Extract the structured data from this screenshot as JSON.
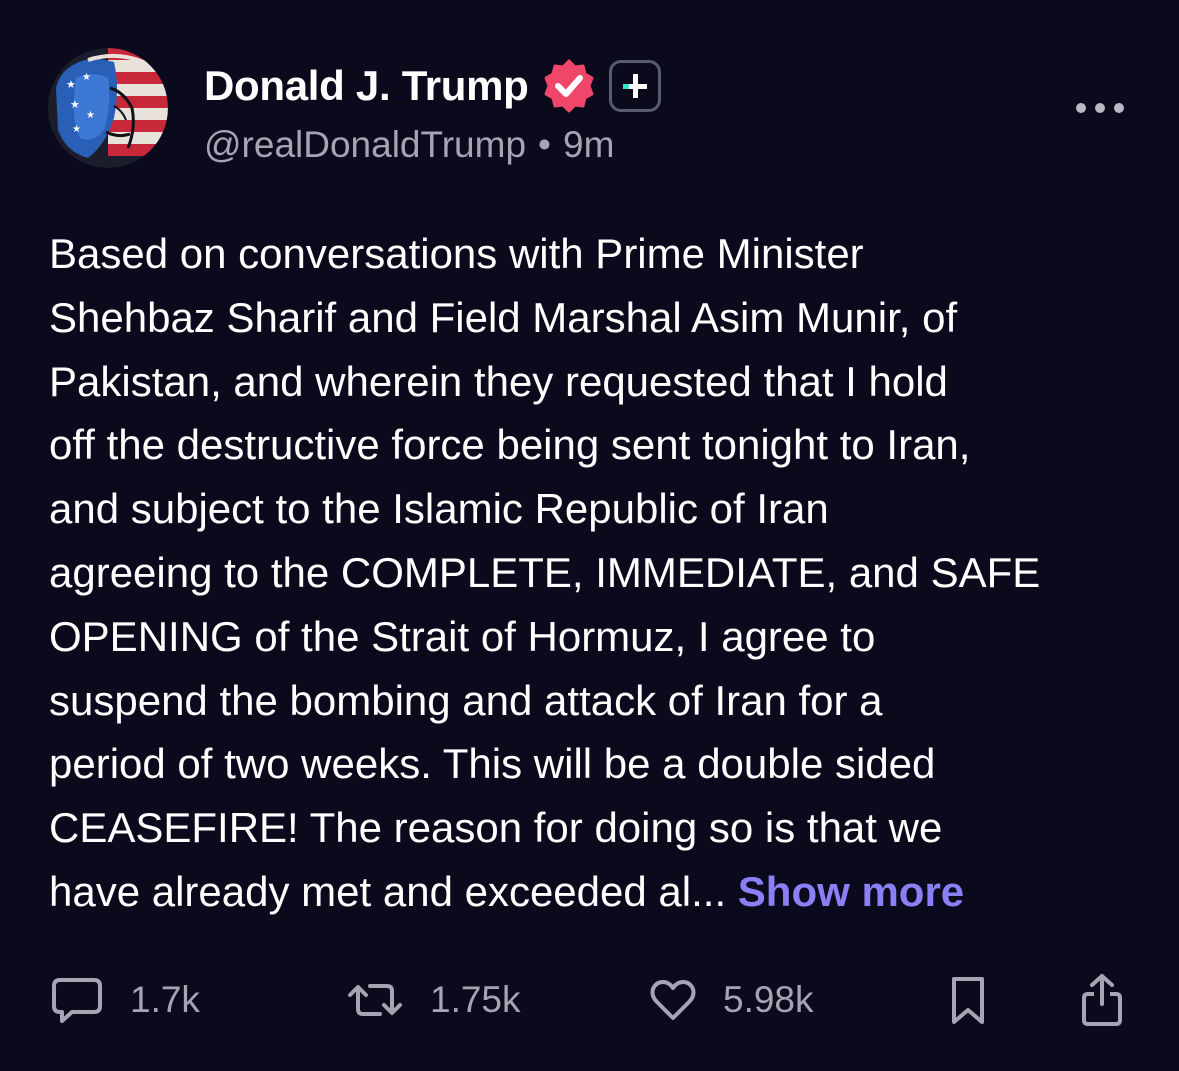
{
  "author": {
    "display_name": "Donald J. Trump",
    "handle": "@realDonaldTrump",
    "separator": "•",
    "time_ago": "9m"
  },
  "post": {
    "lines": [
      "Based on conversations with Prime Minister",
      "Shehbaz Sharif and Field Marshal Asim Munir, of",
      "Pakistan, and wherein they requested that I hold",
      "off the destructive force being sent tonight to Iran,",
      "and subject to the Islamic Republic of Iran",
      "agreeing to the COMPLETE, IMMEDIATE, and SAFE",
      "OPENING of the Strait of Hormuz, I agree to",
      "suspend the bombing and attack of Iran for a",
      "period of two weeks. This will be a double sided",
      "CEASEFIRE! The reason for doing so is that we",
      "have already met and exceeded al..."
    ],
    "show_more_label": "Show more"
  },
  "actions": {
    "reply_count": "1.7k",
    "repost_count": "1.75k",
    "like_count": "5.98k"
  },
  "icons": {
    "verified": "verified-badge-icon",
    "plus": "plus-badge-icon",
    "more": "more-options-icon",
    "reply": "reply-icon",
    "repost": "repost-icon",
    "like": "heart-icon",
    "bookmark": "bookmark-icon",
    "share": "share-icon"
  },
  "colors": {
    "background": "#0b0a1c",
    "text": "#ffffff",
    "secondary_text": "#a4a4b3",
    "link": "#8a80f5",
    "verified_badge": "#f0466a",
    "plus_accent": "#3ee0c6"
  }
}
